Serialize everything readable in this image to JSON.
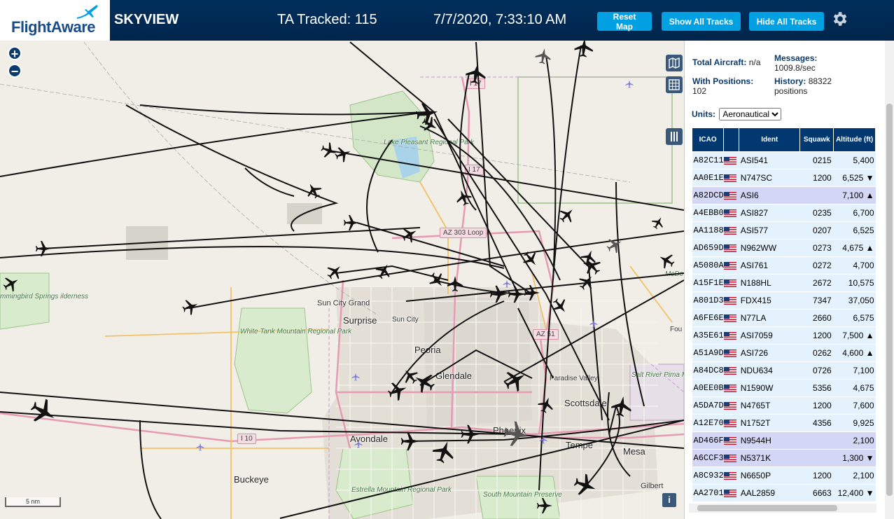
{
  "header": {
    "logo_text": "FlightAware",
    "app_title": "SKYVIEW",
    "tracked_text": "TA Tracked: 115",
    "datetime": "7/7/2020, 7:33:10 AM",
    "buttons": {
      "reset": "Reset Map",
      "show_all": "Show All Tracks",
      "hide_all": "Hide All Tracks"
    },
    "settings_icon": "gear-icon",
    "colors": {
      "bar": "#00254b",
      "button": "#00a0e2"
    }
  },
  "map": {
    "zoom_in": "+",
    "zoom_out": "−",
    "scale_label": "5 nm",
    "info_label": "i",
    "controls": [
      "map-layers-icon",
      "grid-icon",
      "columns-icon"
    ],
    "places": {
      "surprise": "Surprise",
      "sun_city_grand": "Sun City Grand",
      "sun_city": "Sun City",
      "peoria": "Peoria",
      "glendale": "Glendale",
      "phoenix": "Phoenix",
      "avondale": "Avondale",
      "buckeye": "Buckeye",
      "tempe": "Tempe",
      "mesa": "Mesa",
      "scottsdale": "Scottsdale",
      "paradise_valley": "Paradise Valley",
      "gilbert": "Gilbert",
      "fou": "Fou"
    },
    "parks": {
      "lake_pleasant": "Lake Pleasant Regional Park",
      "white_tank": "White Tank Mountain Regional Park",
      "estrella": "Estrella Mountain Regional Park",
      "south_mountain": "South Mountain Preserve",
      "hummingbird": "mmingbird Springs ilderness",
      "salt_river": "Salt River Pima Maricopa Indian Community",
      "mcdowell": "McDo Moun Regio Pa"
    },
    "shields": {
      "i17_north": "I 17",
      "i17": "I 17",
      "az303": "AZ 303 Loop",
      "i10": "I 10",
      "az51": "AZ 51"
    }
  },
  "sidebar": {
    "total_aircraft_label": "Total Aircraft:",
    "total_aircraft_value": "n/a",
    "messages_label": "Messages:",
    "messages_value": "1009.8/sec",
    "with_positions_label": "With Positions:",
    "with_positions_value": "102",
    "history_label": "History:",
    "history_value": "88322",
    "history_unit": "positions",
    "units_label": "Units:",
    "units_selected": "Aeronautical",
    "columns": [
      "ICAO",
      "",
      "Ident",
      "Squawk",
      "Altitude (ft)"
    ],
    "rows": [
      {
        "icao": "A82C11",
        "ident": "ASI541",
        "squawk": "0215",
        "alt": "5,400",
        "trend": "",
        "hl": false
      },
      {
        "icao": "AA0E1E",
        "ident": "N747SC",
        "squawk": "1200",
        "alt": "6,525",
        "trend": "▼",
        "hl": false
      },
      {
        "icao": "A82DCD",
        "ident": "ASI6",
        "squawk": "",
        "alt": "7,100",
        "trend": "▲",
        "hl": true
      },
      {
        "icao": "A4EBB0",
        "ident": "ASI827",
        "squawk": "0235",
        "alt": "6,700",
        "trend": "",
        "hl": false
      },
      {
        "icao": "AA1188",
        "ident": "ASI577",
        "squawk": "0207",
        "alt": "6,525",
        "trend": "",
        "hl": false
      },
      {
        "icao": "AD659D",
        "ident": "N962WW",
        "squawk": "0273",
        "alt": "4,675",
        "trend": "▲",
        "hl": false
      },
      {
        "icao": "A5080A",
        "ident": "ASI761",
        "squawk": "0272",
        "alt": "4,700",
        "trend": "",
        "hl": false
      },
      {
        "icao": "A15F1E",
        "ident": "N188HL",
        "squawk": "2672",
        "alt": "10,575",
        "trend": "",
        "hl": false
      },
      {
        "icao": "A801D3",
        "ident": "FDX415",
        "squawk": "7347",
        "alt": "37,050",
        "trend": "",
        "hl": false
      },
      {
        "icao": "A6FE6E",
        "ident": "N77LA",
        "squawk": "2660",
        "alt": "6,575",
        "trend": "",
        "hl": false
      },
      {
        "icao": "A35E61",
        "ident": "ASI7059",
        "squawk": "1200",
        "alt": "7,500",
        "trend": "▲",
        "hl": false
      },
      {
        "icao": "A51A9D",
        "ident": "ASI726",
        "squawk": "0262",
        "alt": "4,600",
        "trend": "▲",
        "hl": false
      },
      {
        "icao": "A84DC8",
        "ident": "NDU634",
        "squawk": "0726",
        "alt": "7,100",
        "trend": "",
        "hl": false
      },
      {
        "icao": "A0EE0B",
        "ident": "N1590W",
        "squawk": "5356",
        "alt": "4,675",
        "trend": "",
        "hl": false
      },
      {
        "icao": "A5DA7D",
        "ident": "N4765T",
        "squawk": "1200",
        "alt": "7,600",
        "trend": "",
        "hl": false
      },
      {
        "icao": "A12E70",
        "ident": "N1752T",
        "squawk": "4356",
        "alt": "9,925",
        "trend": "",
        "hl": false
      },
      {
        "icao": "AD466F",
        "ident": "N9544H",
        "squawk": "",
        "alt": "2,100",
        "trend": "",
        "hl": true
      },
      {
        "icao": "A6CCF3",
        "ident": "N5371K",
        "squawk": "",
        "alt": "1,300",
        "trend": "▼",
        "hl": true
      },
      {
        "icao": "A8C932",
        "ident": "N6650P",
        "squawk": "1200",
        "alt": "2,100",
        "trend": "",
        "hl": false
      },
      {
        "icao": "AA2701",
        "ident": "AAL2859",
        "squawk": "6663",
        "alt": "12,400",
        "trend": "▼",
        "hl": false
      }
    ]
  }
}
